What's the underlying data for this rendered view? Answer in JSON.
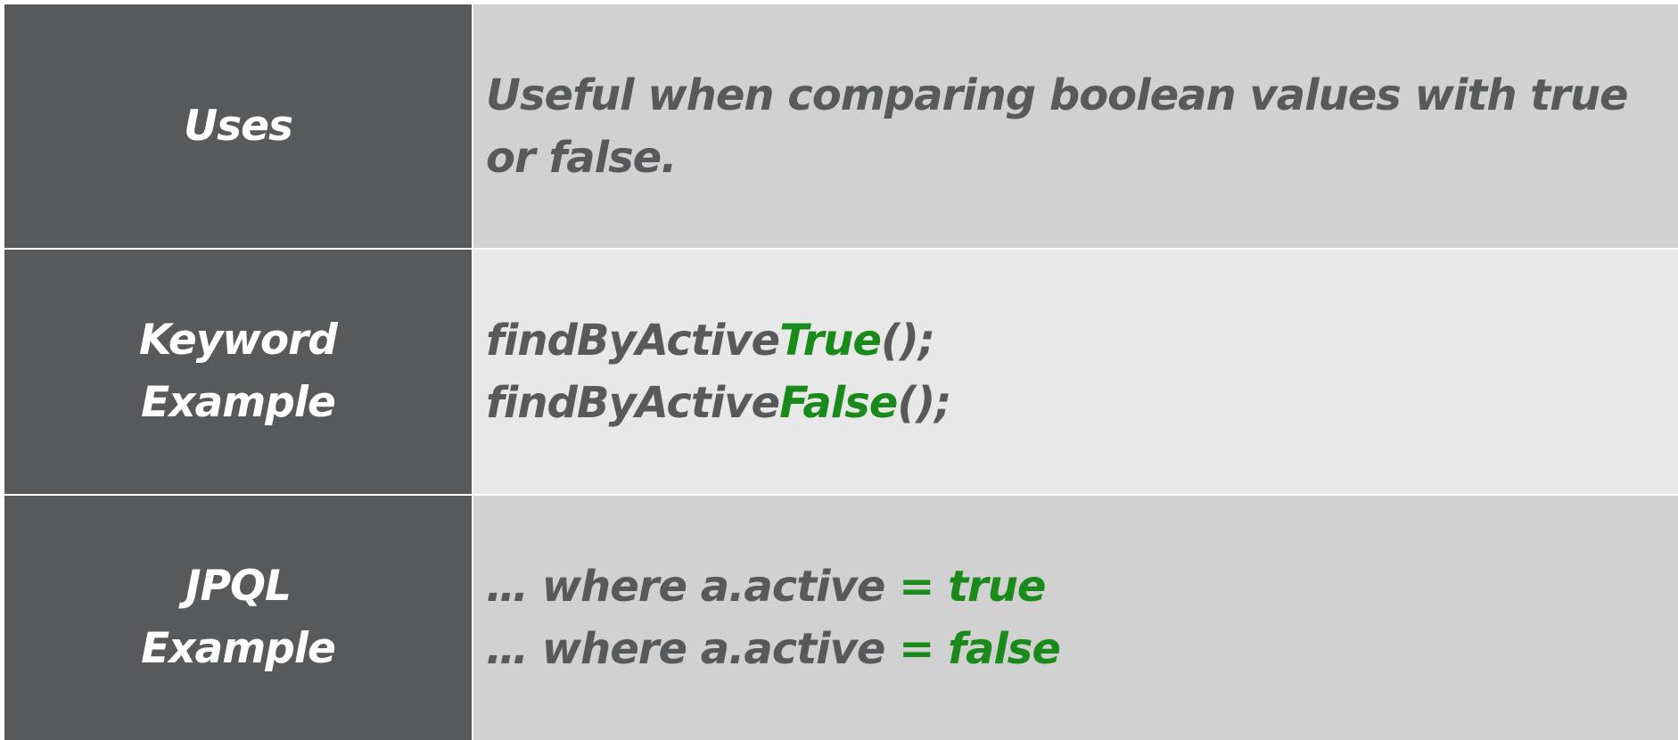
{
  "colors": {
    "label_bg": "#58595b",
    "label_text": "#ffffff",
    "value_text": "#58595b",
    "row_light": "#e8e8e8",
    "row_mid": "#d1d1d1",
    "accent_green": "#1a8a1a"
  },
  "rows": {
    "uses": {
      "label": "Uses",
      "text": "Useful when comparing boolean values with true or false."
    },
    "keyword": {
      "label_line1": "Keyword",
      "label_line2": "Example",
      "line1_prefix": "findByActive",
      "line1_accent": "True",
      "line1_suffix": "();",
      "line2_prefix": "findByActive",
      "line2_accent": "False",
      "line2_suffix": "();"
    },
    "jpql": {
      "label_line1": "JPQL",
      "label_line2": "Example",
      "line1_prefix": "… where a.active",
      "line1_accent": " = true",
      "line2_prefix": "… where a.active",
      "line2_accent": " = false"
    }
  }
}
